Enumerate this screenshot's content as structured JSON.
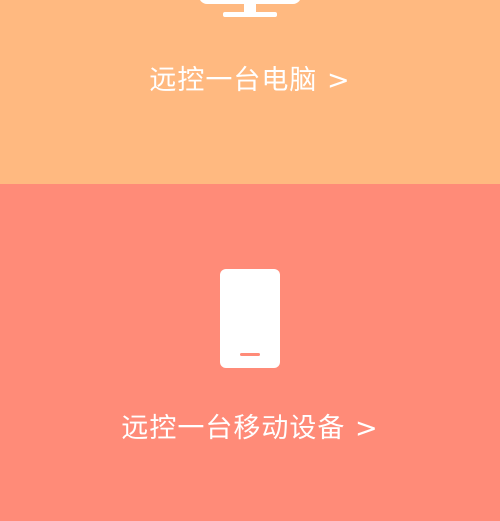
{
  "remote_computer": {
    "label": "远控一台电脑 >",
    "icon": "monitor-icon",
    "background": "#FFB980"
  },
  "remote_mobile": {
    "label": "远控一台移动设备 >",
    "icon": "phone-icon",
    "background": "#FF8B78"
  }
}
